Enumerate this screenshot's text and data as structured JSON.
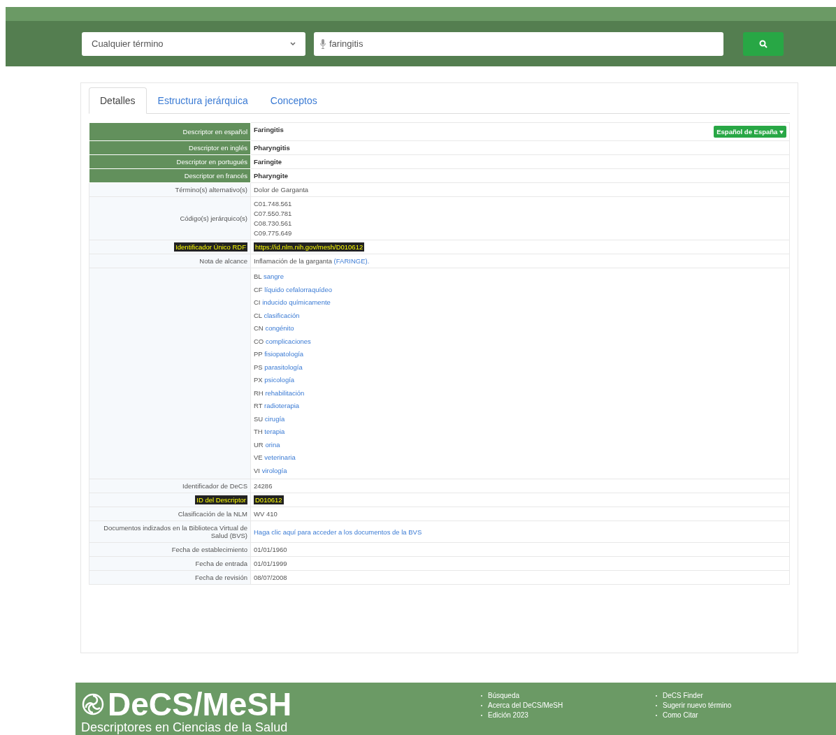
{
  "search": {
    "field_select": "Cualquier término",
    "query": "faringitis"
  },
  "tabs": [
    {
      "label": "Detalles",
      "selected": true
    },
    {
      "label": "Estructura jerárquica",
      "selected": false
    },
    {
      "label": "Conceptos",
      "selected": false
    }
  ],
  "language_button": "Español de España",
  "rows": [
    {
      "label": "Descriptor en español",
      "kind": "primary",
      "highlight": false,
      "values": [
        "Faringitis"
      ]
    },
    {
      "label": "Descriptor en inglés",
      "kind": "primary",
      "highlight": false,
      "values": [
        "Pharyngitis"
      ]
    },
    {
      "label": "Descriptor en portugués",
      "kind": "primary",
      "highlight": false,
      "values": [
        "Faringite"
      ]
    },
    {
      "label": "Descriptor en francés",
      "kind": "primary",
      "highlight": false,
      "values": [
        "Pharyngite"
      ]
    },
    {
      "label": "Término(s) alternativo(s)",
      "kind": "plain",
      "highlight": false,
      "values": [
        "Dolor de Garganta"
      ]
    },
    {
      "label": "Código(s) jerárquico(s)",
      "kind": "plain",
      "highlight": false,
      "values": [
        "C01.748.561",
        "C07.550.781",
        "C08.730.561",
        "C09.775.649"
      ]
    },
    {
      "label": "Identificador Único RDF",
      "kind": "plain",
      "highlight": true,
      "values": [
        "https://id.nlm.nih.gov/mesh/D010612"
      ]
    },
    {
      "label": "Nota de alcance",
      "kind": "note",
      "highlight": false,
      "values": [
        "Inflamación de la garganta"
      ],
      "link": "(FARINGE)."
    },
    {
      "kind": "qualifiers",
      "highlight": false,
      "qualifiers": [
        {
          "code": "BL",
          "name": "sangre"
        },
        {
          "code": "CF",
          "name": "líquido cefalorraquídeo"
        },
        {
          "code": "CI",
          "name": "inducido químicamente"
        },
        {
          "code": "CL",
          "name": "clasificación"
        },
        {
          "code": "CN",
          "name": "congénito"
        },
        {
          "code": "CO",
          "name": "complicaciones"
        },
        {
          "code": "PP",
          "name": "fisiopatología"
        },
        {
          "code": "PS",
          "name": "parasitología"
        },
        {
          "code": "PX",
          "name": "psicología"
        },
        {
          "code": "RH",
          "name": "rehabilitación"
        },
        {
          "code": "RT",
          "name": "radioterapia"
        },
        {
          "code": "SU",
          "name": "cirugía"
        },
        {
          "code": "TH",
          "name": "terapia"
        },
        {
          "code": "UR",
          "name": "orina"
        },
        {
          "code": "VE",
          "name": "veterinaria"
        },
        {
          "code": "VI",
          "name": "virología"
        }
      ]
    },
    {
      "label": "Identificador de DeCS",
      "kind": "plain",
      "highlight": false,
      "values": [
        "24286"
      ]
    },
    {
      "label": "ID del Descriptor",
      "kind": "plain",
      "highlight": true,
      "values": [
        "D010612"
      ]
    },
    {
      "label": "Clasificación de la NLM",
      "kind": "plain",
      "highlight": false,
      "values": [
        "WV 410"
      ]
    },
    {
      "label": "Documentos indizados en la Biblioteca Virtual de Salud (BVS)",
      "kind": "link",
      "highlight": false,
      "link": "Haga clic aquí para acceder a los documentos de la BVS"
    },
    {
      "label": "Fecha de establecimiento",
      "kind": "plain",
      "highlight": false,
      "values": [
        "01/01/1960"
      ]
    },
    {
      "label": "Fecha de entrada",
      "kind": "plain",
      "highlight": false,
      "values": [
        "01/01/1999"
      ]
    },
    {
      "label": "Fecha de revisión",
      "kind": "plain",
      "highlight": false,
      "values": [
        "08/07/2008"
      ]
    }
  ],
  "footer": {
    "logo": "DeCS/MeSH",
    "subtitle": "Descriptores en Ciencias de la Salud",
    "links_1": [
      "Búsqueda",
      "Acerca del DeCS/MeSH",
      "Edición 2023"
    ],
    "links_2": [
      "DeCS Finder",
      "Sugerir nuevo término",
      "Como Citar"
    ]
  }
}
